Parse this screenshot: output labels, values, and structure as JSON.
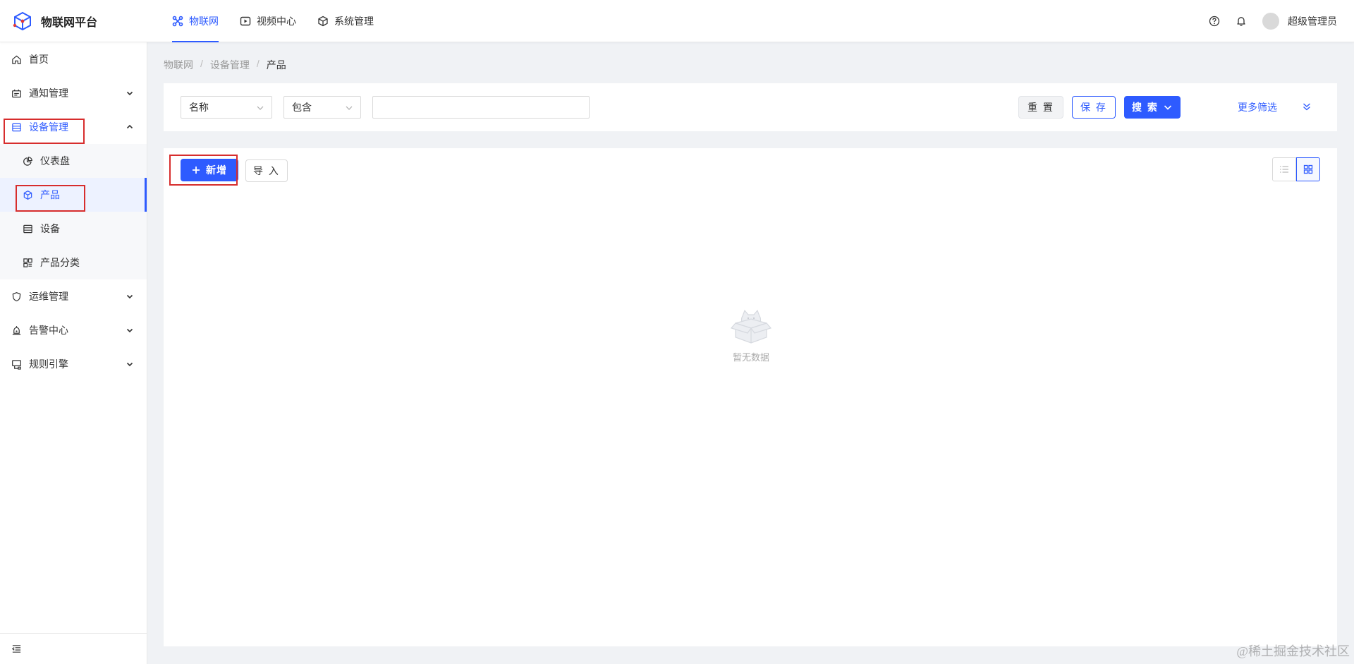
{
  "app": {
    "title": "物联网平台"
  },
  "topnav": {
    "items": [
      {
        "label": "物联网",
        "icon": "iot-icon",
        "active": true
      },
      {
        "label": "视频中心",
        "icon": "video-play-icon",
        "active": false
      },
      {
        "label": "系统管理",
        "icon": "system-cube-icon",
        "active": false
      }
    ]
  },
  "user": {
    "name": "超级管理员"
  },
  "sidebar": {
    "items": [
      {
        "label": "首页",
        "icon": "home-icon"
      },
      {
        "label": "通知管理",
        "icon": "notification-icon",
        "expandable": true
      },
      {
        "label": "设备管理",
        "icon": "device-icon",
        "expanded": true,
        "children": [
          {
            "label": "仪表盘",
            "icon": "dashboard-pie-icon"
          },
          {
            "label": "产品",
            "icon": "product-cube-icon",
            "selected": true
          },
          {
            "label": "设备",
            "icon": "device-list-icon"
          },
          {
            "label": "产品分类",
            "icon": "category-grid-icon"
          }
        ]
      },
      {
        "label": "运维管理",
        "icon": "shield-icon",
        "expandable": true
      },
      {
        "label": "告警中心",
        "icon": "alarm-icon",
        "expandable": true
      },
      {
        "label": "规则引擎",
        "icon": "rule-engine-icon",
        "expandable": true
      }
    ]
  },
  "breadcrumb": {
    "items": [
      "物联网",
      "设备管理",
      "产品"
    ],
    "separator": "/"
  },
  "filter": {
    "field": "名称",
    "operator": "包含",
    "value": "",
    "reset_label": "重 置",
    "save_label": "保 存",
    "search_label": "搜 索",
    "more_label": "更多筛选"
  },
  "toolbar": {
    "add_label": "新增",
    "import_label": "导 入"
  },
  "empty": {
    "text": "暂无数据"
  },
  "watermark": "@稀土掘金技术社区",
  "colors": {
    "primary": "#2e5bff",
    "highlight_box": "#d72d2d",
    "background": "#f0f2f5"
  }
}
